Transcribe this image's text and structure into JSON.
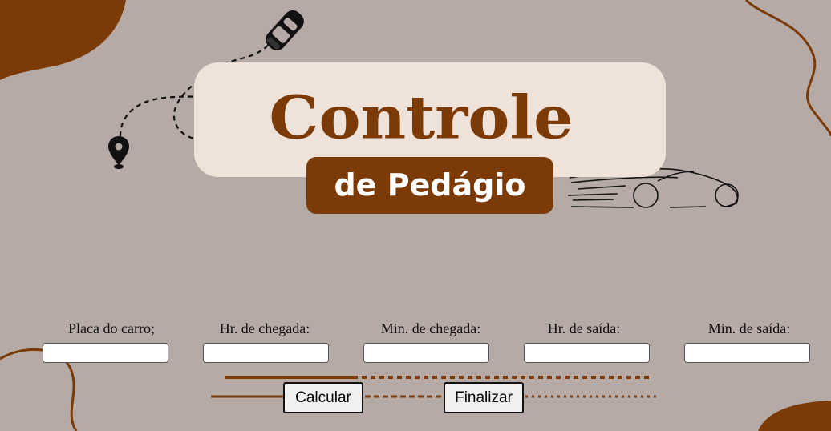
{
  "header": {
    "title": "Controle",
    "subtitle": "de Pedágio"
  },
  "form": {
    "fields": [
      {
        "label": "Placa do carro;",
        "value": ""
      },
      {
        "label": "Hr. de chegada:",
        "value": ""
      },
      {
        "label": "Min. de chegada:",
        "value": ""
      },
      {
        "label": "Hr. de saída:",
        "value": ""
      },
      {
        "label": "Min. de saída:",
        "value": ""
      }
    ]
  },
  "actions": {
    "calculate_label": "Calcular",
    "finish_label": "Finalizar"
  },
  "colors": {
    "background": "#b5aaa5",
    "brand_brown": "#7c3a06",
    "title_card": "#efe3d9"
  }
}
